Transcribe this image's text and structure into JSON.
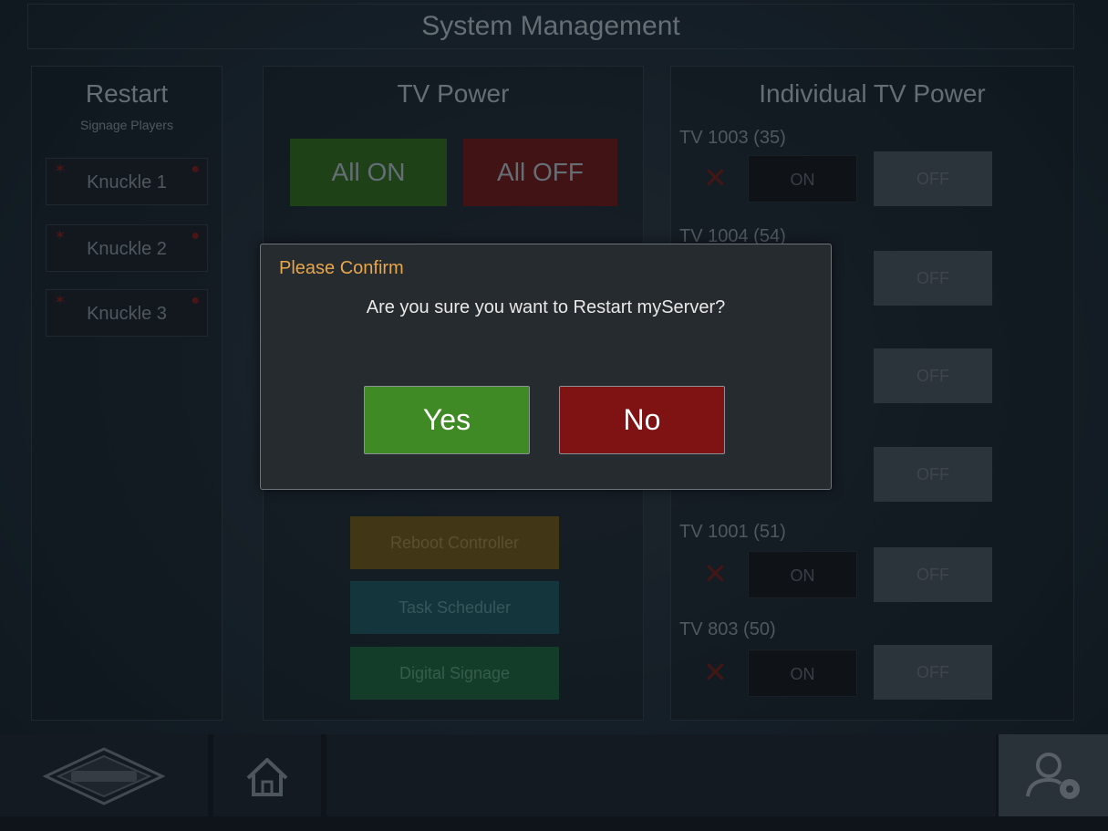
{
  "header": {
    "title": "System Management"
  },
  "restart_panel": {
    "title": "Restart",
    "subtitle": "Signage Players",
    "items": [
      {
        "label": "Knuckle 1"
      },
      {
        "label": "Knuckle 2"
      },
      {
        "label": "Knuckle 3"
      }
    ]
  },
  "tv_power": {
    "title": "TV Power",
    "all_on": "All ON",
    "all_off": "All OFF"
  },
  "middle_buttons": [
    {
      "label": "Reboot Controller",
      "color": "#7a6420"
    },
    {
      "label": "Task Scheduler",
      "color": "#1d6a74"
    },
    {
      "label": "Digital Signage",
      "color": "#1f7a45"
    }
  ],
  "individual_tv": {
    "title": "Individual TV Power",
    "on_label": "ON",
    "off_label": "OFF",
    "tvs": [
      {
        "label": "TV 1003 (35)"
      },
      {
        "label": "TV 1004 (54)"
      },
      {
        "label": ""
      },
      {
        "label": ""
      },
      {
        "label": "TV 1001 (51)"
      },
      {
        "label": "TV 803 (50)"
      }
    ]
  },
  "dialog": {
    "title": "Please Confirm",
    "message": "Are you sure you want to Restart myServer?",
    "yes_label": "Yes",
    "no_label": "No"
  },
  "footer": {
    "logo_icon": "brand-logo",
    "home_icon": "home-icon",
    "user_icon": "user-settings-icon"
  },
  "colors": {
    "confirm_title": "#e7a64a",
    "yes": "#3f8a25",
    "no": "#7f1313"
  }
}
